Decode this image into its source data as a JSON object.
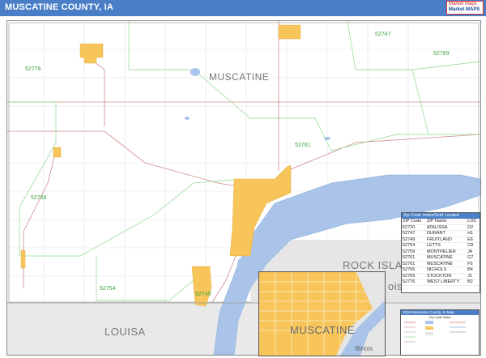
{
  "header": {
    "title": "MUSCATINE COUNTY, IA",
    "brand_line1": "Market Maps",
    "brand_line2": "Market MAPS"
  },
  "map": {
    "county_labels": {
      "muscatine": "MUSCATINE",
      "louisa": "LOUISA",
      "rock_island": "ROCK ISLAND",
      "illinois_fragment": "ois",
      "inset_muscatine": "MUSCATINE",
      "inset_illinois": "Illinois"
    },
    "zip_labels": [
      "52747",
      "52769",
      "52776",
      "52761",
      "52766",
      "52754",
      "52749"
    ]
  },
  "locator": {
    "title": "Zip Code Index/Grid Locator",
    "headers": [
      "ZIP Code",
      "ZIP Name",
      "LOC"
    ],
    "rows": [
      [
        "52720",
        "ATALISSA",
        "D2"
      ],
      [
        "52747",
        "DURANT",
        "H1"
      ],
      [
        "52749",
        "FRUITLAND",
        "E6"
      ],
      [
        "52754",
        "LETTS",
        "C8"
      ],
      [
        "52759",
        "MONTPELIER",
        "J4"
      ],
      [
        "52761",
        "MUSCATINE",
        "G7"
      ],
      [
        "52761",
        "MUSCATINE",
        "F5"
      ],
      [
        "52766",
        "NICHOLS",
        "B4"
      ],
      [
        "52769",
        "STOCKTON",
        "J1"
      ],
      [
        "52776",
        "WEST LIBERTY",
        "B2"
      ]
    ]
  },
  "legend": {
    "title": "2018 Muscatine County, IA Map",
    "subtitle": "Zip Code Index"
  },
  "colors": {
    "header_bar": "#4a7fc7",
    "urban": "#f7c55a",
    "water": "#a9c4e8",
    "zip_boundary": "#7ccf7c",
    "roads": "#d8a0a0",
    "county_line": "#999999"
  }
}
